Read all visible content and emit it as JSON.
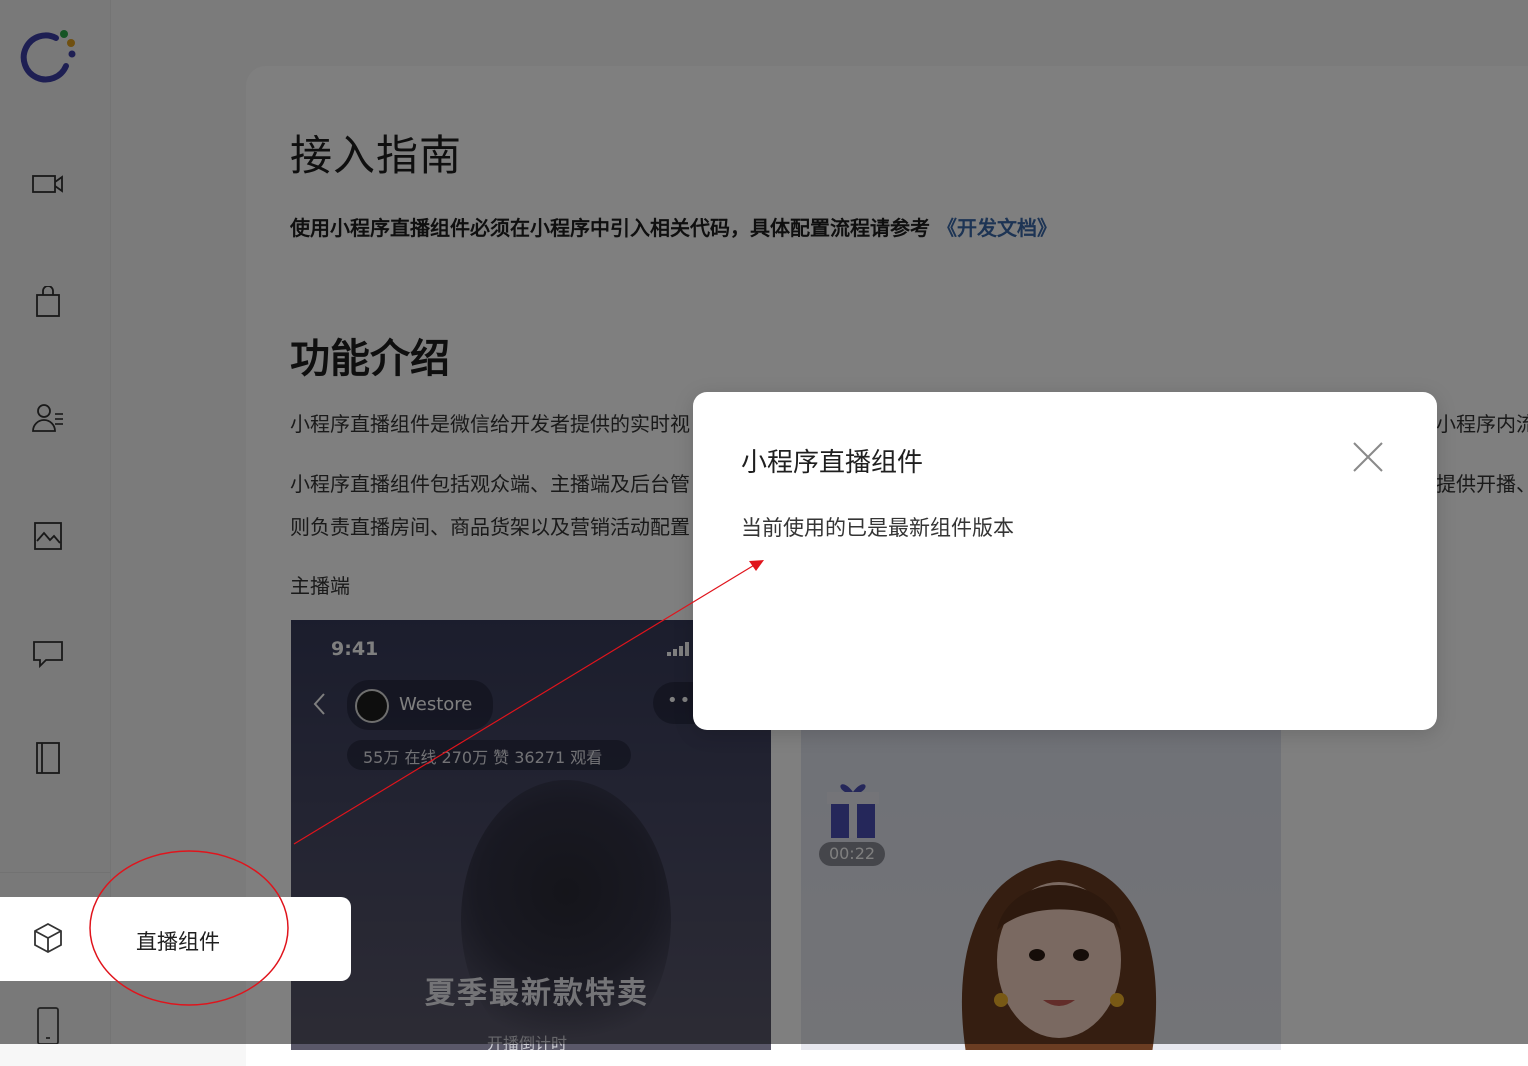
{
  "sidebar": {
    "items": [
      {
        "icon": "video-icon"
      },
      {
        "icon": "shopping-bag-icon"
      },
      {
        "icon": "user-list-icon"
      },
      {
        "icon": "chart-image-icon"
      },
      {
        "icon": "message-icon"
      },
      {
        "icon": "book-icon"
      }
    ],
    "bottom_items": [
      {
        "icon": "cube-icon",
        "label": "直播组件"
      },
      {
        "icon": "tablet-icon"
      }
    ]
  },
  "main": {
    "guide_title": "接入指南",
    "guide_text": "使用小程序直播组件必须在小程序中引入相关代码，具体配置流程请参考",
    "guide_link": "《开发文档》",
    "feature_title": "功能介绍",
    "para1_left": "小程序直播组件是微信给开发者提供的实时视",
    "para1_right": "小程序内流",
    "para2_left": "小程序直播组件包括观众端、主播端及后台管",
    "para2_right": "提供开播、",
    "para3_left": "则负责直播房间、商品货架以及营销活动配置",
    "section_label": "主播端",
    "phone1": {
      "time": "9:41",
      "room_name": "Westore",
      "stats": "55万 在线  270万 赞  36271 观看",
      "sale_text": "夏季最新款特卖",
      "countdown": "开播倒计时"
    },
    "phone2": {
      "gift_time": "00:22"
    }
  },
  "dialog": {
    "title": "小程序直播组件",
    "body": "当前使用的已是最新组件版本"
  },
  "colors": {
    "link": "#3b69a9",
    "logo_ring": "#3d3fa6",
    "annotation": "#e0141c"
  }
}
